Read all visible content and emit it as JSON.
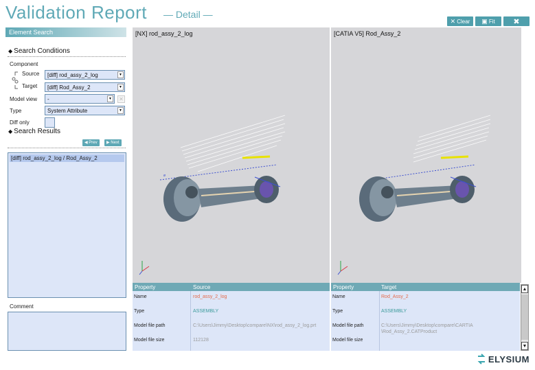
{
  "header": {
    "title": "Validation Report",
    "subtitle": "— Detail —"
  },
  "toolbar": {
    "clear_label": "Clear",
    "fit_label": "Fit"
  },
  "sidebar": {
    "panel_title": "Element Search",
    "search_conditions_title": "Search Conditions",
    "component_label": "Component",
    "source_label": "Source",
    "source_value": "[diff] rod_assy_2_log",
    "target_label": "Target",
    "target_value": "[diff] Rod_Assy_2",
    "model_view_label": "Model view",
    "model_view_value": "-",
    "type_label": "Type",
    "type_value": "System Attribute",
    "diff_only_label": "Diff only",
    "search_results_title": "Search Results",
    "prev_label": "Prev",
    "next_label": "Next",
    "results": [
      "[diff] rod_assy_2_log / Rod_Assy_2"
    ],
    "comment_label": "Comment"
  },
  "viewports": {
    "left_title": "[NX] rod_assy_2_log",
    "right_title": "[CATIA V5] Rod_Assy_2"
  },
  "properties": {
    "left": {
      "col_property": "Property",
      "col_value": "Source",
      "rows": [
        {
          "key": "Name",
          "value": "rod_assy_2_log"
        },
        {
          "key": "Type",
          "value": "ASSEMBLY"
        },
        {
          "key": "Model file path",
          "value": "C:\\Users\\Jimmy\\Desktop\\compare\\NX\\rod_assy_2_log.prt"
        },
        {
          "key": "Model file size",
          "value": "112128"
        }
      ]
    },
    "right": {
      "col_property": "Property",
      "col_value": "Target",
      "rows": [
        {
          "key": "Name",
          "value": "Rod_Assy_2"
        },
        {
          "key": "Type",
          "value": "ASSEMBLY"
        },
        {
          "key": "Model file path",
          "value_line1": "C:\\Users\\Jimmy\\Desktop\\compare\\CARTIA",
          "value_line2": "\\Rod_Assy_2.CATProduct"
        },
        {
          "key": "Model file size",
          "value": ""
        }
      ]
    }
  },
  "branding": {
    "logo_text": "ELYSIUM"
  },
  "colors": {
    "accent": "#5fa9b6",
    "field_bg": "#dde6f8",
    "diff_red": "#e46a4a",
    "type_teal": "#3a9a9a"
  },
  "icons": [
    "close-icon",
    "fit-icon",
    "tools-icon",
    "link-icon",
    "dropdown-arrow-icon",
    "prev-icon",
    "next-icon",
    "axis-triad-icon",
    "elysium-logo-icon"
  ]
}
